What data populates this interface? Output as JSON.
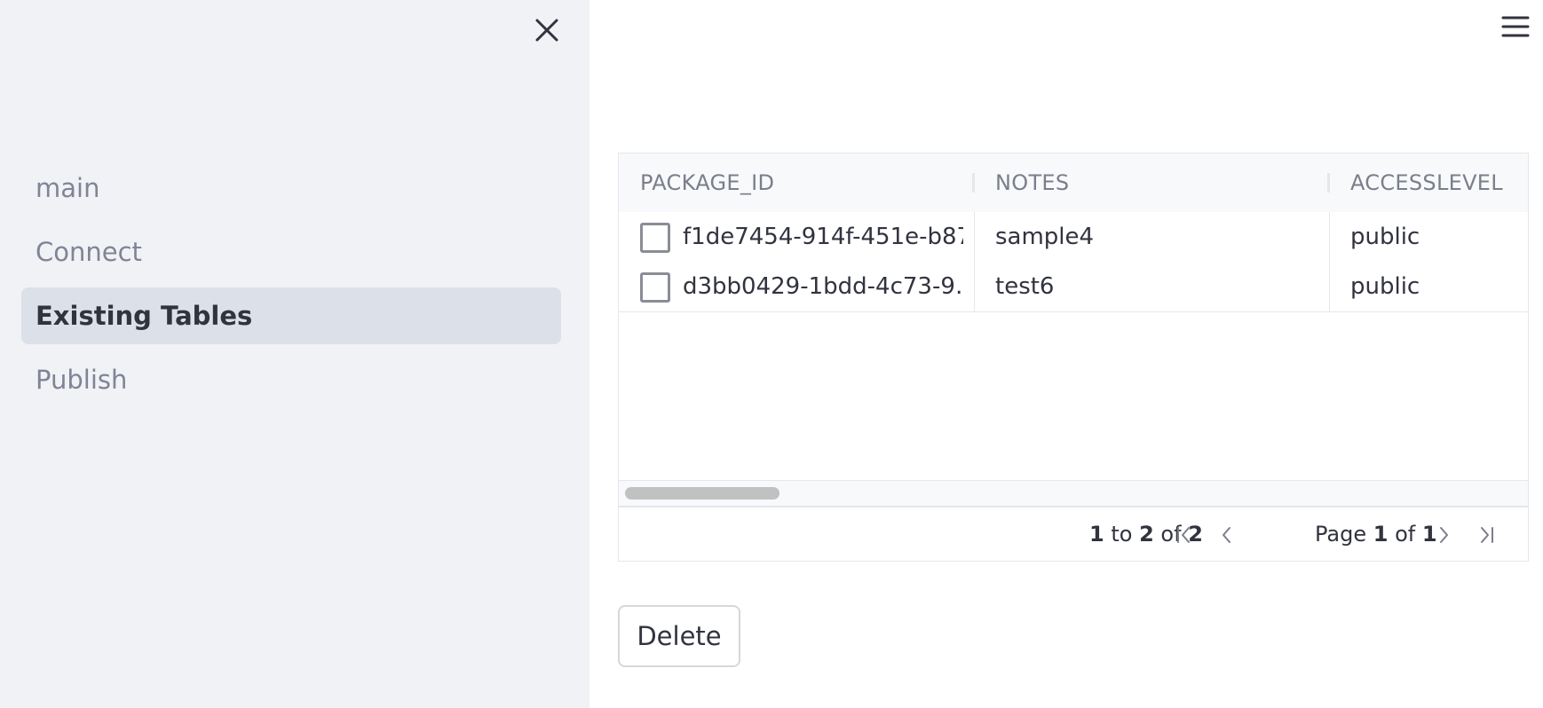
{
  "sidebar": {
    "items": [
      {
        "label": "main"
      },
      {
        "label": "Connect"
      },
      {
        "label": "Existing Tables"
      },
      {
        "label": "Publish"
      }
    ],
    "active_index": 2
  },
  "table": {
    "columns": [
      "PACKAGE_ID",
      "NOTES",
      "ACCESSLEVEL"
    ],
    "rows": [
      {
        "package_id": "f1de7454-914f-451e-b87…",
        "notes": "sample4",
        "accesslevel": "public"
      },
      {
        "package_id": "d3bb0429-1bdd-4c73-9…",
        "notes": "test6",
        "accesslevel": "public"
      }
    ]
  },
  "pagination": {
    "from": "1",
    "to_word": "to",
    "to": "2",
    "of_word": "of",
    "total": "2",
    "page_word": "Page",
    "page": "1",
    "page_of_word": "of",
    "page_total": "1"
  },
  "actions": {
    "delete_label": "Delete"
  },
  "icons": [
    "close-icon",
    "hamburger-icon",
    "first-page-icon",
    "prev-page-icon",
    "next-page-icon",
    "last-page-icon"
  ]
}
